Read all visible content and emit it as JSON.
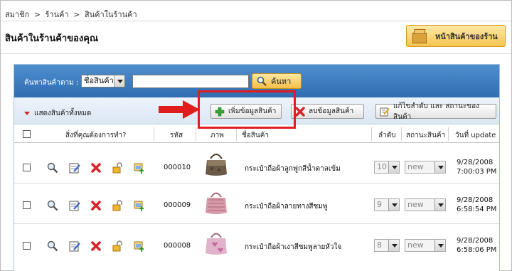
{
  "breadcrumb": {
    "item1": "สมาชิก",
    "sep1": ">",
    "item2": "ร้านค้า",
    "sep2": ">",
    "item3": "สินค้าในร้านค้า"
  },
  "page": {
    "title": "สินค้าในร้านค้าของคุณ",
    "shop_button": "หน้าสินค้าของร้าน"
  },
  "search": {
    "label": "ค้นหาสินค้าตาม :",
    "field_selected": "ชื่อสินค้า",
    "query": "",
    "button": "ค้นหา"
  },
  "toolbar": {
    "show_all": "แสดงสินค้าทั้งหมด",
    "add_button": "เพิ่มข้อมูลสินค้า",
    "delete_button": "ลบข้อมูลสินค้า",
    "edit_button": "แก้ไขลำดับ และ สถานะของสินค้า"
  },
  "table": {
    "columns": {
      "action": "สิ่งที่คุณต้องการทำ?",
      "code": "รหัส",
      "image": "ภาพ",
      "name": "ชื่อสินค้า",
      "order": "ลำดับ",
      "status": "สถานะสินค้า",
      "updated": "วันที่ update"
    },
    "rows": [
      {
        "code": "000010",
        "name": "กระเป๋าถือผ้าลูกฟูกสีน้ำตาลเข้ม",
        "order": "10",
        "status": "new",
        "date": "9/28/2008",
        "time": "7:00:03 PM"
      },
      {
        "code": "000009",
        "name": "กระเป๋าถือผ้าลายทางสีชมพู",
        "order": "9",
        "status": "new",
        "date": "9/28/2008",
        "time": "6:58:54 PM"
      },
      {
        "code": "000008",
        "name": "กระเป๋าถือผ้าเงาสีชมพูลายหัวใจ",
        "order": "8",
        "status": "new",
        "date": "9/28/2008",
        "time": "6:58:06 PM"
      }
    ]
  },
  "colors": {
    "panel_header": "#3b7cc0",
    "highlight": "#e01c1c",
    "button_gold": "#f4bf48"
  }
}
